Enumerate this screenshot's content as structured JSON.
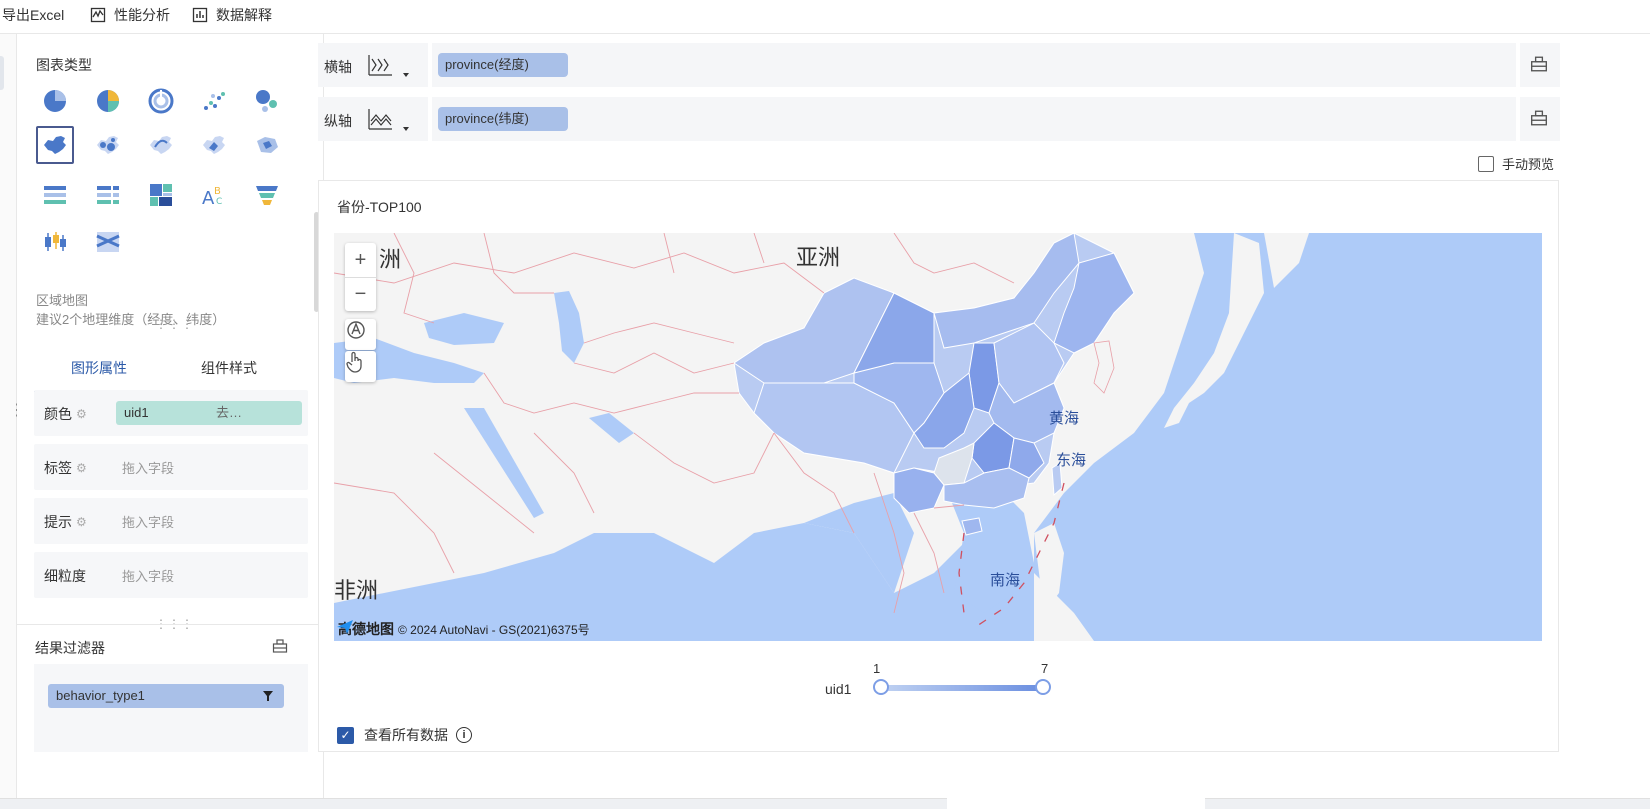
{
  "toolbar": {
    "export_label": "导出Excel",
    "perf_label": "性能分析",
    "explain_label": "数据解释"
  },
  "chart_panel": {
    "title": "图表类型",
    "selected_type_name": "区域地图",
    "selected_type_hint": "建议2个地理维度（经度、纬度）"
  },
  "prop_tabs": {
    "graphic": "图形属性",
    "style": "组件样式"
  },
  "props": {
    "color_label": "颜色",
    "color_field": "uid1",
    "color_field_more": "去…",
    "label_label": "标签",
    "tip_label": "提示",
    "granularity_label": "细粒度",
    "drop_placeholder": "拖入字段"
  },
  "filter": {
    "title": "结果过滤器",
    "field": "behavior_type1"
  },
  "axes": {
    "x_label": "横轴",
    "x_field": "province(经度)",
    "y_label": "纵轴",
    "y_field": "province(纬度)"
  },
  "manual_preview": "手动预览",
  "card": {
    "title": "省份-TOP100"
  },
  "map": {
    "labels": {
      "asia_partial": "洲",
      "asia": "亚洲",
      "africa_partial": "非洲",
      "yellow_sea": "黄海",
      "east_sea": "东海",
      "south_sea": "南海"
    },
    "attribution_brand": "高德地图",
    "attribution": "© 2024 AutoNavi - GS(2021)6375号",
    "zoom_in": "+",
    "zoom_out": "−",
    "colors": {
      "land": "#f4f4f4",
      "water": "#aecbf8",
      "region_light": "#b9cbf2",
      "region_mid": "#9db5ef",
      "region_dark": "#7b99e6",
      "border": "#e8a0a8"
    }
  },
  "legend": {
    "field": "uid1",
    "min": "1",
    "max": "7"
  },
  "view_all": "查看所有数据",
  "colors": {
    "accent": "#2c5aa8",
    "pill_blue": "#a9c0e8",
    "pill_teal": "#b7e2da"
  }
}
